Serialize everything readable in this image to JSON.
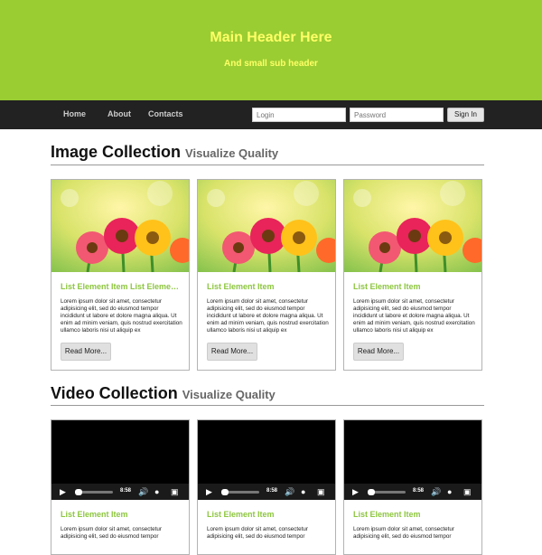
{
  "header": {
    "title": "Main Header Here",
    "subtitle": "And small sub header"
  },
  "nav": {
    "links": [
      "Home",
      "About",
      "Contacts"
    ],
    "login_placeholder": "Login",
    "password_placeholder": "Password",
    "signin_label": "Sign In"
  },
  "image_section": {
    "title": "Image Collection",
    "subtitle": "Visualize Quality",
    "cards": [
      {
        "title": "List Element Item List Element Item",
        "text": "Lorem ipsum dolor sit amet, consectetur adipisicing elit, sed do eiusmod tempor incididunt ut labore et dolore magna aliqua. Ut enim ad minim veniam, quis nostrud exercitation ullamco laboris nisi ut aliquip ex",
        "button": "Read More..."
      },
      {
        "title": "List Element Item",
        "text": "Lorem ipsum dolor sit amet, consectetur adipisicing elit, sed do eiusmod tempor incididunt ut labore et dolore magna aliqua. Ut enim ad minim veniam, quis nostrud exercitation ullamco laboris nisi ut aliquip ex",
        "button": "Read More..."
      },
      {
        "title": "List Element Item",
        "text": "Lorem ipsum dolor sit amet, consectetur adipisicing elit, sed do eiusmod tempor incididunt ut labore et dolore magna aliqua. Ut enim ad minim veniam, quis nostrud exercitation ullamco laboris nisi ut aliquip ex",
        "button": "Read More..."
      }
    ]
  },
  "video_section": {
    "title": "Video Collection",
    "subtitle": "Visualize Quality",
    "cards": [
      {
        "title": "List Element Item",
        "text": "Lorem ipsum dolor sit amet, consectetur adipisicing elit, sed do eiusmod tempor",
        "time": "8:58"
      },
      {
        "title": "List Element Item",
        "text": "Lorem ipsum dolor sit amet, consectetur adipisicing elit, sed do eiusmod tempor",
        "time": "8:58"
      },
      {
        "title": "List Element Item",
        "text": "Lorem ipsum dolor sit amet, consectetur adipisicing elit, sed do eiusmod tempor",
        "time": "8:58"
      }
    ]
  },
  "colors": {
    "brand_green": "#9acd32",
    "header_text": "#ffff66",
    "accent_title": "#8dc63f",
    "nav_bg": "#222222"
  }
}
